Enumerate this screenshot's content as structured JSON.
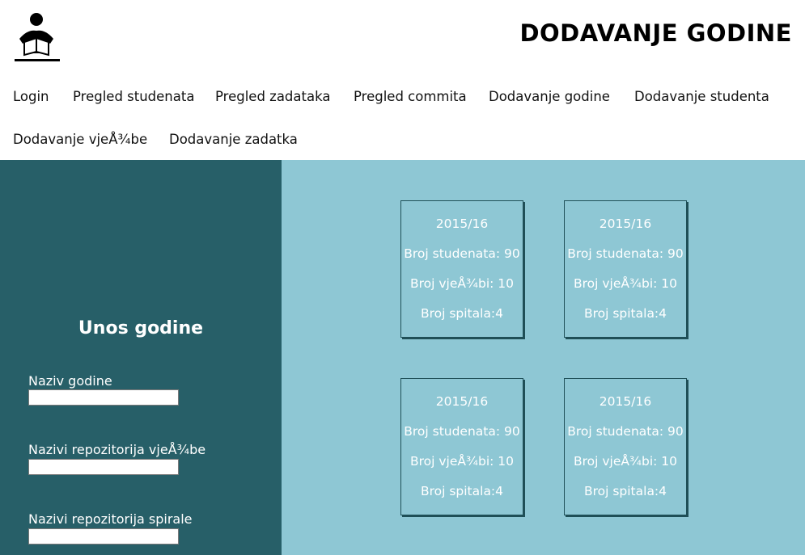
{
  "header": {
    "title": "DODAVANJE GODINE",
    "logo_icon": "reader-icon"
  },
  "nav": {
    "items": [
      {
        "label": "Login"
      },
      {
        "label": "Pregled studenata"
      },
      {
        "label": "Pregled zadataka"
      },
      {
        "label": "Pregled commita"
      },
      {
        "label": "Dodavanje godine"
      },
      {
        "label": "Dodavanje studenta"
      },
      {
        "label": "Dodavanje vjeÅ¾be"
      },
      {
        "label": "Dodavanje zadatka"
      }
    ]
  },
  "form": {
    "title": "Unos godine",
    "fields": [
      {
        "label": "Naziv godine",
        "value": ""
      },
      {
        "label": "Nazivi repozitorija vjeÅ¾be",
        "value": ""
      },
      {
        "label": "Nazivi repozitorija spirale",
        "value": ""
      }
    ]
  },
  "cards": [
    {
      "year": "2015/16",
      "students": "Broj studenata: 90",
      "exercises": "Broj vjeÅ¾bi: 10",
      "spirals": "Broj spitala:4"
    },
    {
      "year": "2015/16",
      "students": "Broj studenata: 90",
      "exercises": "Broj vjeÅ¾bi: 10",
      "spirals": "Broj spitala:4"
    },
    {
      "year": "2015/16",
      "students": "Broj studenata: 90",
      "exercises": "Broj vjeÅ¾bi: 10",
      "spirals": "Broj spitala:4"
    },
    {
      "year": "2015/16",
      "students": "Broj studenata: 90",
      "exercises": "Broj vjeÅ¾bi: 10",
      "spirals": "Broj spitala:4"
    }
  ],
  "colors": {
    "left_panel": "#275f68",
    "right_panel": "#8ec7d4",
    "card_border": "#1f4f57"
  }
}
